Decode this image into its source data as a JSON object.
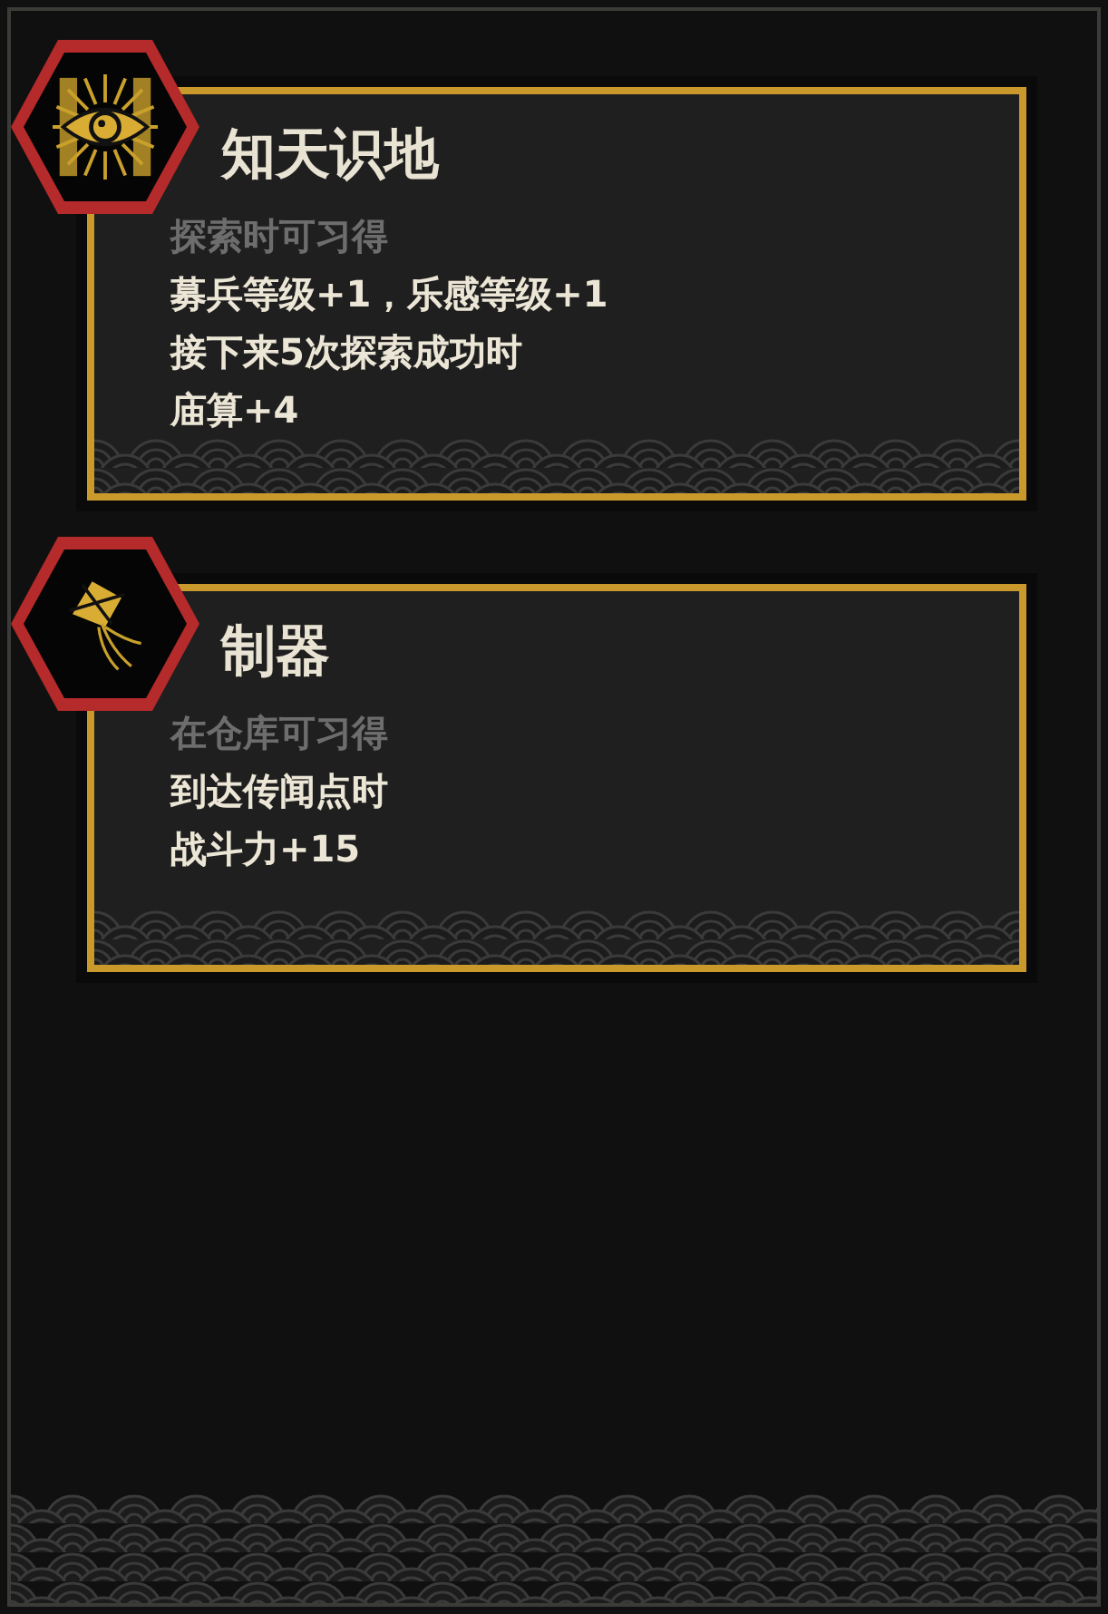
{
  "skills": [
    {
      "title": "知天识地",
      "source": "探索时可习得",
      "effects": [
        "募兵等级+1，乐感等级+1",
        "接下来5次探索成功时",
        "庙算+4"
      ]
    },
    {
      "title": "制器",
      "source": "在仓库可习得",
      "effects": [
        "到达传闻点时",
        "战斗力+15"
      ]
    }
  ]
}
